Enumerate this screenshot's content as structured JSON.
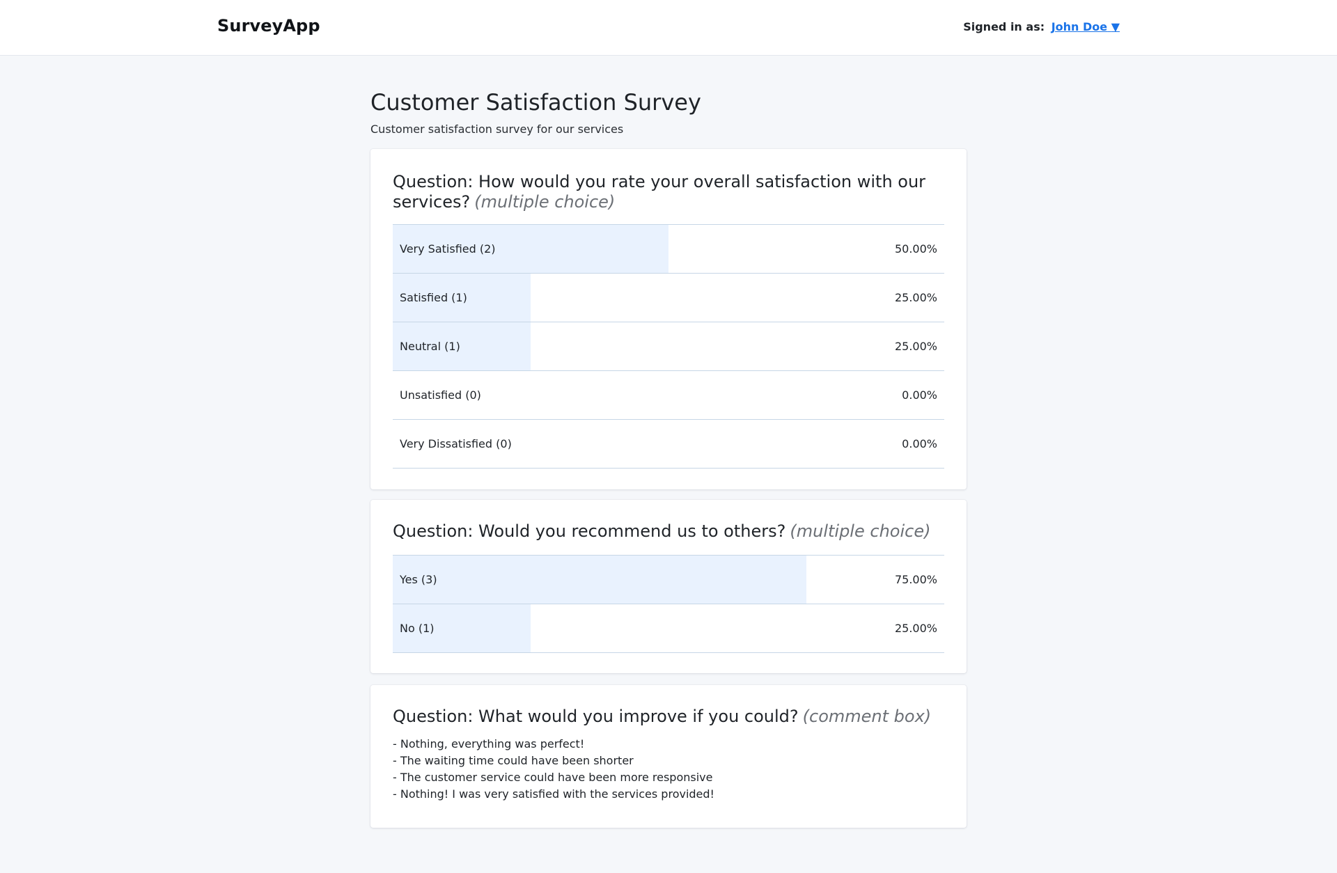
{
  "header": {
    "brand": "SurveyApp",
    "signed_in_label": "Signed in as:",
    "user_name": "John Doe",
    "caret": "▼"
  },
  "survey": {
    "title": "Customer Satisfaction Survey",
    "description": "Customer satisfaction survey for our services"
  },
  "questions": [
    {
      "title": "Question: How would you rate your overall satisfaction with our services?",
      "type": "(multiple choice)",
      "options": [
        {
          "label": "Very Satisfied (2)",
          "percent_text": "50.00%",
          "fraction": 0.5
        },
        {
          "label": "Satisfied (1)",
          "percent_text": "25.00%",
          "fraction": 0.25
        },
        {
          "label": "Neutral (1)",
          "percent_text": "25.00%",
          "fraction": 0.25
        },
        {
          "label": "Unsatisfied (0)",
          "percent_text": "0.00%",
          "fraction": 0
        },
        {
          "label": "Very Dissatisfied (0)",
          "percent_text": "0.00%",
          "fraction": 0
        }
      ]
    },
    {
      "title": "Question: Would you recommend us to others?",
      "type": "(multiple choice)",
      "options": [
        {
          "label": "Yes (3)",
          "percent_text": "75.00%",
          "fraction": 0.75
        },
        {
          "label": "No (1)",
          "percent_text": "25.00%",
          "fraction": 0.25
        }
      ]
    },
    {
      "title": "Question: What would you improve if you could?",
      "type": "(comment box)",
      "comments": [
        "- Nothing, everything was perfect!",
        "- The waiting time could have been shorter",
        "- The customer service could have been more responsive",
        "- Nothing! I was very satisfied with the services provided!"
      ]
    }
  ],
  "colors": {
    "link": "#1a73e8",
    "bar_fill": "#e9f2fe",
    "row_border": "#c6d6e6"
  }
}
